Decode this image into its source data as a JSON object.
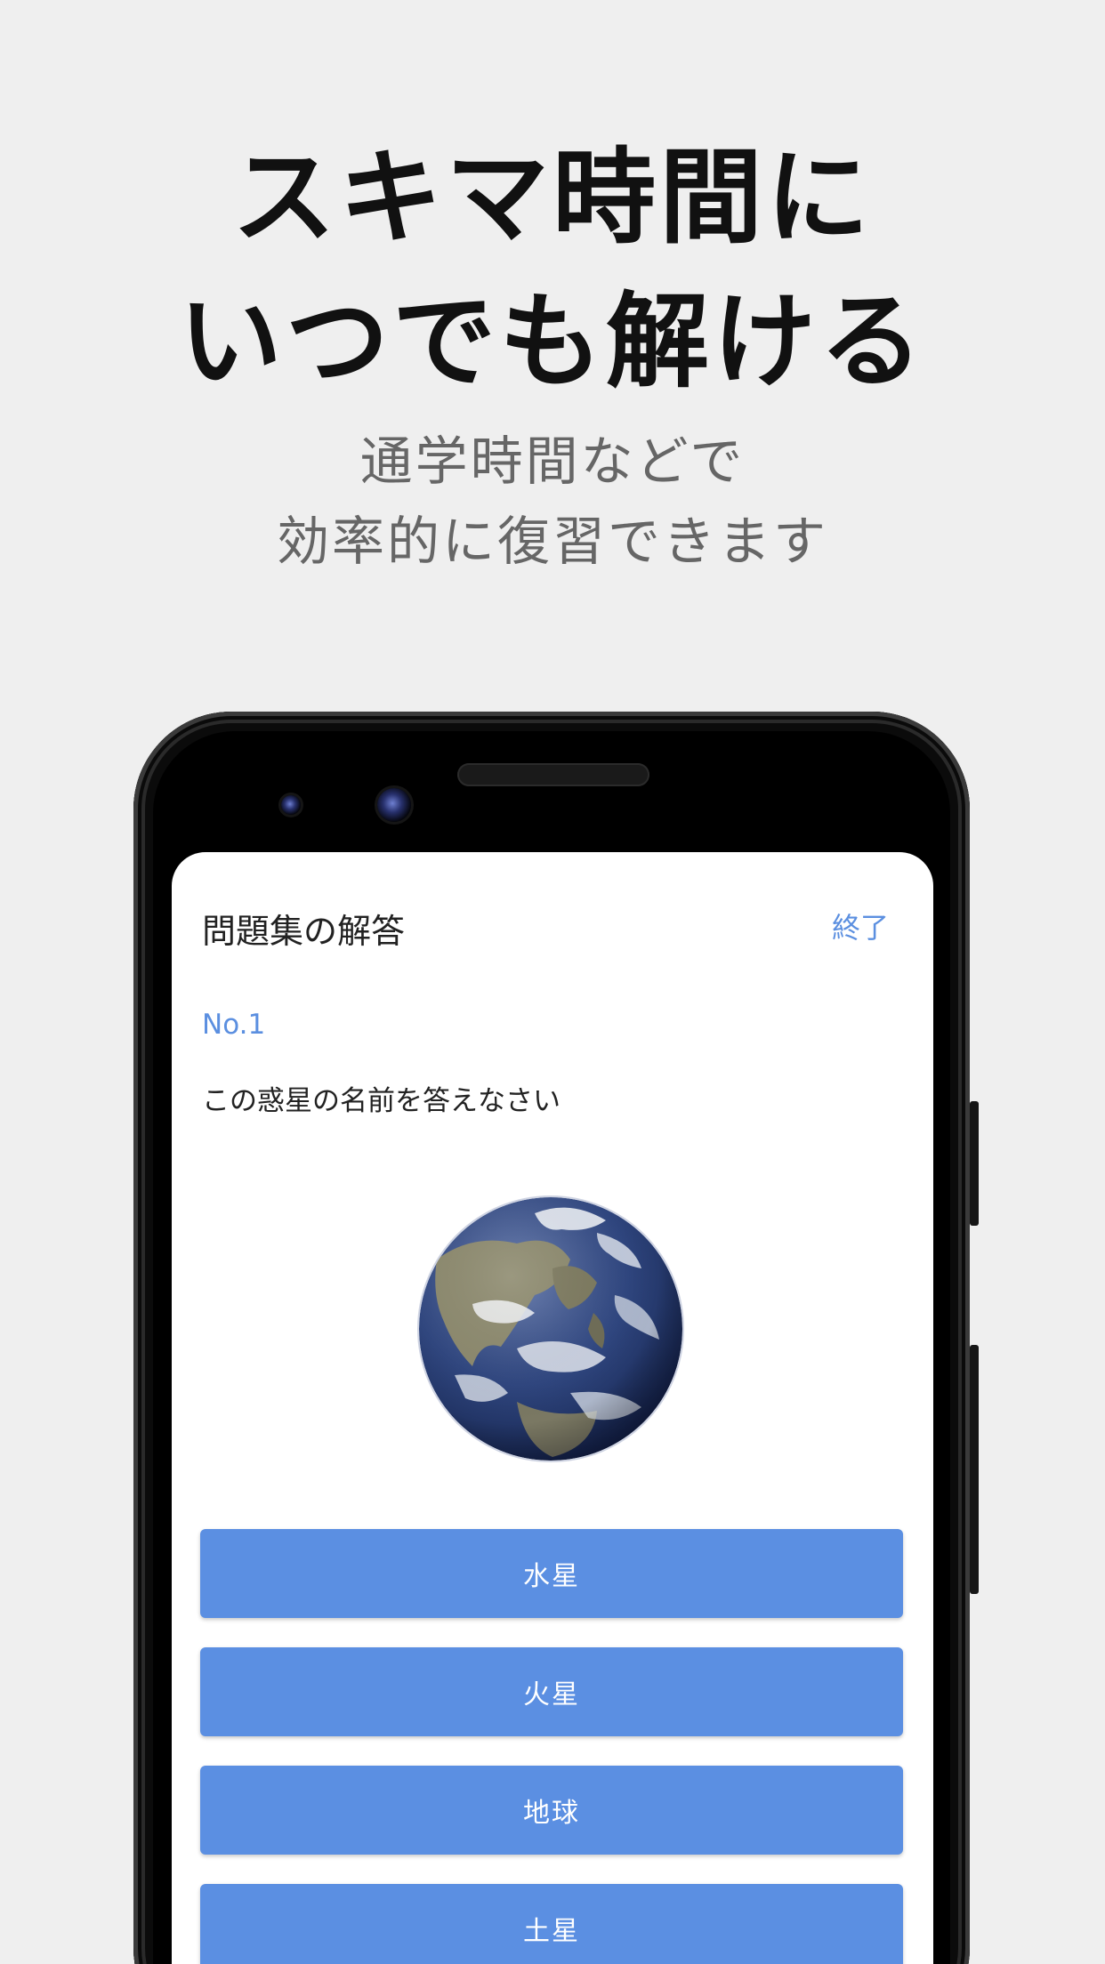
{
  "headline": {
    "line1": "スキマ時間に",
    "line2": "いつでも解ける"
  },
  "subcopy": {
    "line1": "通学時間などで",
    "line2": "効率的に復習できます"
  },
  "app": {
    "title": "問題集の解答",
    "end_label": "終了",
    "question_number": "No.1",
    "question_text": "この惑星の名前を答えなさい",
    "image_icon": "earth-image",
    "choices": [
      "水星",
      "火星",
      "地球",
      "土星"
    ]
  },
  "colors": {
    "background": "#efefef",
    "accent": "#5b8fe2",
    "headline": "#111111",
    "subcopy": "#666666"
  }
}
